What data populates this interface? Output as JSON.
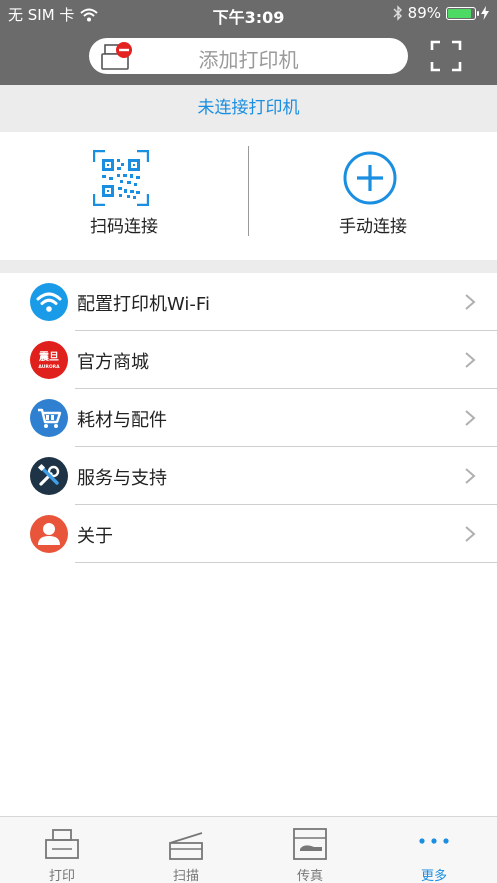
{
  "status_bar": {
    "carrier": "无 SIM 卡",
    "time": "下午3:09",
    "battery": "89%",
    "battery_level": 0.89
  },
  "header": {
    "search_placeholder": "添加打印机"
  },
  "notice": "未连接打印机",
  "connect": {
    "scan_label": "扫码连接",
    "manual_label": "手动连接"
  },
  "menu": [
    {
      "label": "配置打印机Wi-Fi",
      "icon": "wifi-icon",
      "color": "#1a9be8"
    },
    {
      "label": "官方商城",
      "icon": "aurora-logo-icon",
      "color": "#e0201c",
      "logo_text": "震旦",
      "logo_sub": "AURORA"
    },
    {
      "label": "耗材与配件",
      "icon": "cart-icon",
      "color": "#2f80d0"
    },
    {
      "label": "服务与支持",
      "icon": "tools-icon",
      "color": "#1f3347"
    },
    {
      "label": "关于",
      "icon": "user-icon",
      "color": "#e8553b"
    }
  ],
  "tabs": [
    {
      "label": "打印",
      "icon": "print-icon"
    },
    {
      "label": "扫描",
      "icon": "scan-icon"
    },
    {
      "label": "传真",
      "icon": "fax-icon"
    },
    {
      "label": "更多",
      "icon": "more-icon",
      "active": true
    }
  ],
  "colors": {
    "accent": "#1a8ee0",
    "header_bg": "#6b6b6b"
  }
}
